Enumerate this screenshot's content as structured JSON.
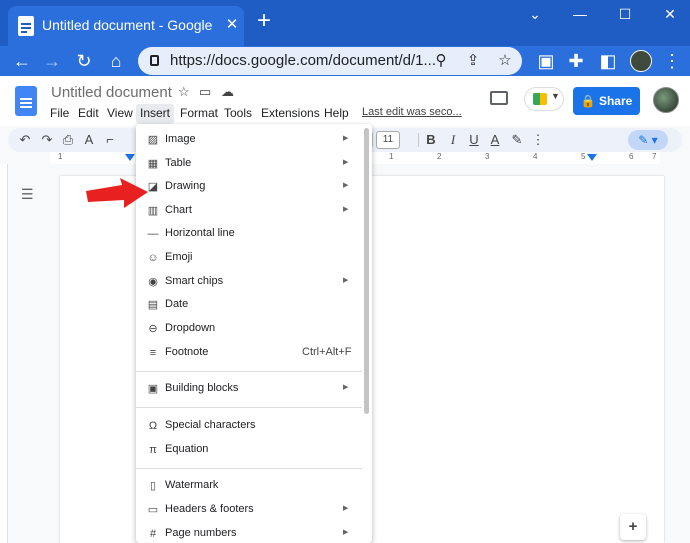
{
  "browser": {
    "tab_title": "Untitled document - Google Docs",
    "tab_close": "✕",
    "new_tab": "+",
    "url": "https://docs.google.com/document/d/1...",
    "window_controls": {
      "restore_down": "⌄",
      "minimize": "—",
      "maximize": "☐",
      "close": "✕"
    }
  },
  "doc": {
    "title": "Untitled document",
    "menus": [
      "File",
      "Edit",
      "View",
      "Insert",
      "Format",
      "Tools",
      "Extensions",
      "Help"
    ],
    "active_menu": "Insert",
    "last_edit": "Last edit was seco...",
    "share_label": "Share"
  },
  "toolbar": {
    "font_size": "11"
  },
  "ruler": {
    "numbers": [
      "1",
      "1",
      "2",
      "3",
      "4",
      "5",
      "6",
      "7"
    ]
  },
  "insert_menu": {
    "items": [
      {
        "label": "Image",
        "icon": "image-icon",
        "submenu": true
      },
      {
        "label": "Table",
        "icon": "table-icon",
        "submenu": true
      },
      {
        "label": "Drawing",
        "icon": "drawing-icon",
        "submenu": true
      },
      {
        "label": "Chart",
        "icon": "chart-icon",
        "submenu": true
      },
      {
        "label": "Horizontal line",
        "icon": "horizontal-line-icon",
        "submenu": false
      },
      {
        "label": "Emoji",
        "icon": "emoji-icon",
        "submenu": false
      },
      {
        "label": "Smart chips",
        "icon": "smart-chips-icon",
        "submenu": true
      },
      {
        "label": "Date",
        "icon": "date-icon",
        "submenu": false
      },
      {
        "label": "Dropdown",
        "icon": "dropdown-icon",
        "submenu": false
      },
      {
        "label": "Footnote",
        "icon": "footnote-icon",
        "submenu": false,
        "shortcut": "Ctrl+Alt+F"
      },
      {
        "label": "Building blocks",
        "icon": "building-blocks-icon",
        "submenu": true
      },
      {
        "label": "Special characters",
        "icon": "omega-icon",
        "submenu": false
      },
      {
        "label": "Equation",
        "icon": "pi-icon",
        "submenu": false
      },
      {
        "label": "Watermark",
        "icon": "watermark-icon",
        "submenu": false
      },
      {
        "label": "Headers & footers",
        "icon": "headers-footers-icon",
        "submenu": true
      },
      {
        "label": "Page numbers",
        "icon": "page-numbers-icon",
        "submenu": true
      }
    ]
  },
  "colors": {
    "chrome_blue": "#1f5cc4",
    "share_blue": "#1a73e8",
    "annotation_red": "#e8201f"
  }
}
